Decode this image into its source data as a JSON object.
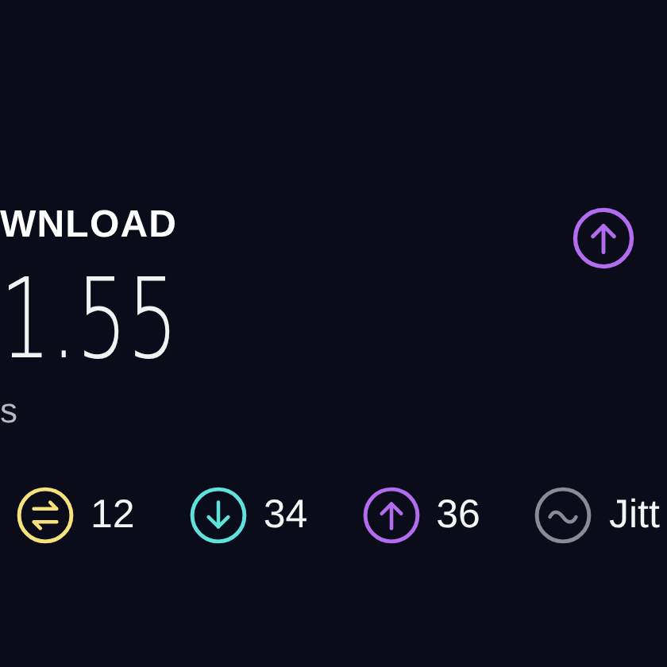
{
  "result": {
    "label": "WNLOAD",
    "value": "1.55",
    "unit": "s"
  },
  "next_test": {
    "kind": "upload",
    "color": "#b36cf0"
  },
  "stats": [
    {
      "kind": "ping",
      "color": "#f5e27c",
      "text": "12"
    },
    {
      "kind": "download",
      "color": "#5fe1dc",
      "text": "34"
    },
    {
      "kind": "upload",
      "color": "#b36cf0",
      "text": "36"
    },
    {
      "kind": "jitter",
      "color": "#8b8b96",
      "text": "Jitt"
    }
  ]
}
